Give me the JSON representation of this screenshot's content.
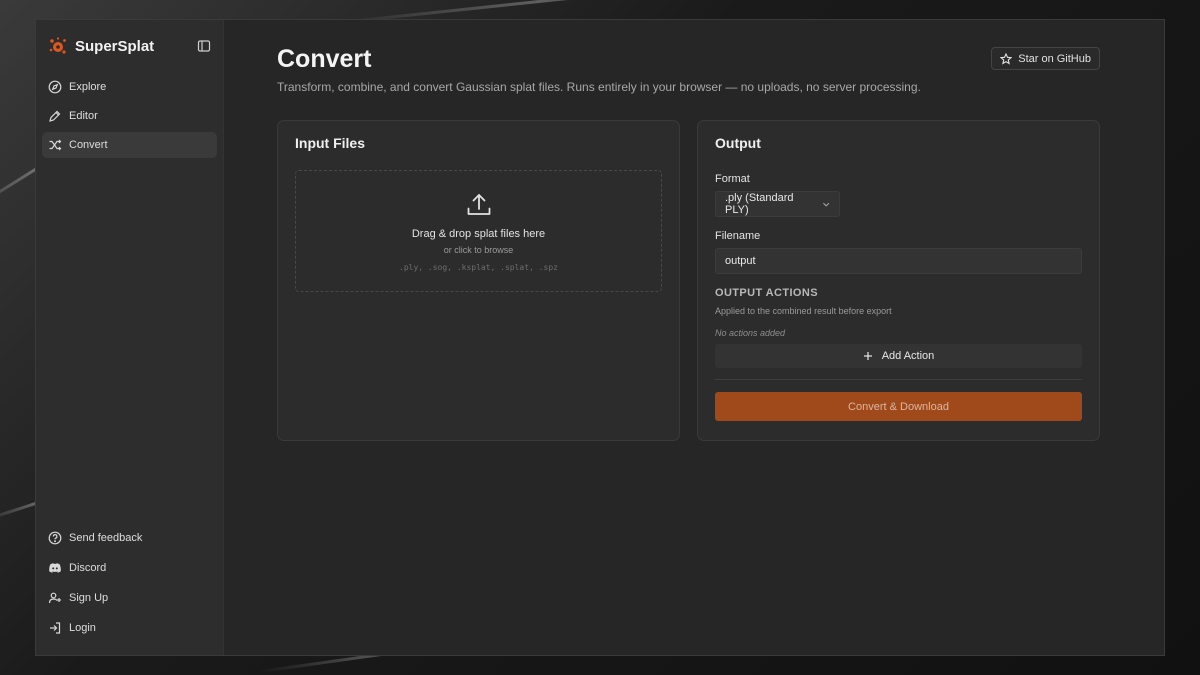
{
  "app": {
    "name": "SuperSplat"
  },
  "sidebar": {
    "items": [
      {
        "label": "Explore",
        "icon": "compass-icon"
      },
      {
        "label": "Editor",
        "icon": "pen-icon"
      },
      {
        "label": "Convert",
        "icon": "shuffle-icon",
        "active": true
      }
    ],
    "bottom": [
      {
        "label": "Send feedback",
        "icon": "help-circle-icon"
      },
      {
        "label": "Discord",
        "icon": "discord-icon"
      },
      {
        "label": "Sign Up",
        "icon": "user-plus-icon"
      },
      {
        "label": "Login",
        "icon": "login-icon"
      }
    ]
  },
  "header": {
    "title": "Convert",
    "subtitle": "Transform, combine, and convert Gaussian splat files. Runs entirely in your browser — no uploads, no server processing.",
    "github_label": "Star on GitHub"
  },
  "input_card": {
    "title": "Input Files",
    "drop_title": "Drag & drop splat files here",
    "drop_sub": "or click to browse",
    "extensions": ".ply, .sog, .ksplat, .splat, .spz"
  },
  "output_card": {
    "title": "Output",
    "format_label": "Format",
    "format_value": ".ply (Standard PLY)",
    "filename_label": "Filename",
    "filename_value": "output",
    "actions_heading": "OUTPUT ACTIONS",
    "actions_desc": "Applied to the combined result before export",
    "actions_empty": "No actions added",
    "add_action_label": "Add Action",
    "convert_label": "Convert & Download"
  },
  "colors": {
    "accent": "#a04a1c",
    "logo": "#e0561f",
    "background": "#262626"
  }
}
